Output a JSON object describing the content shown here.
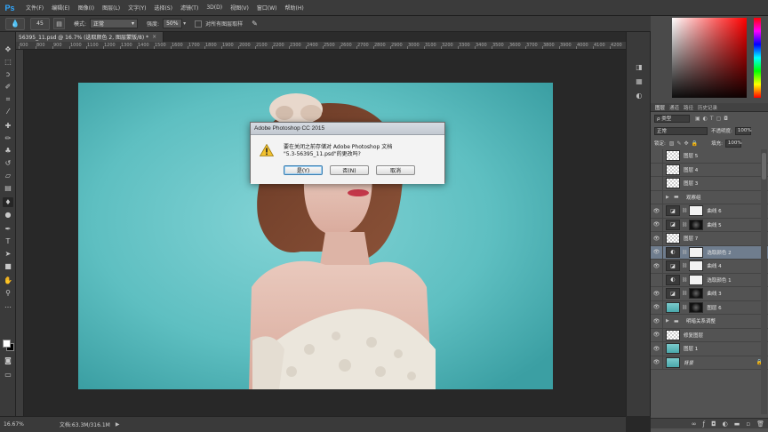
{
  "app": {
    "logo": "Ps"
  },
  "menu": [
    "文件(F)",
    "编辑(E)",
    "图像(I)",
    "图层(L)",
    "文字(Y)",
    "选择(S)",
    "滤镜(T)",
    "3D(D)",
    "视图(V)",
    "窗口(W)",
    "帮助(H)"
  ],
  "options": {
    "brush_size": "45",
    "mode_label": "模式:",
    "mode_value": "正常",
    "strength_label": "强度:",
    "strength_value": "50%",
    "sample_all_label": "对所有图层取样"
  },
  "document": {
    "tab_title": "56395_11.psd @ 16.7% (选取颜色 2, 图层蒙版/8) *",
    "ruler_ticks": [
      "600",
      "800",
      "900",
      "1000",
      "1100",
      "1200",
      "1300",
      "1400",
      "1500",
      "1600",
      "1700",
      "1800",
      "1900",
      "2000",
      "2100",
      "2200",
      "2300",
      "2400",
      "2500",
      "2600",
      "2700",
      "2800",
      "2900",
      "3000",
      "3100",
      "3200",
      "3300",
      "3400",
      "3500",
      "3600",
      "3700",
      "3800",
      "3900",
      "4000",
      "4100",
      "4200"
    ]
  },
  "status": {
    "zoom": "16.67%",
    "doc_info": "文档:63.3M/316.1M"
  },
  "dialog": {
    "title": "Adobe Photoshop CC 2015",
    "message_line1": "要在关闭之前存储对 Adobe Photoshop 文档",
    "message_line2": "\"5.3-56395_11.psd\"的更改吗?",
    "buttons": {
      "yes": "是(Y)",
      "no": "否(N)",
      "cancel": "取消"
    }
  },
  "layers_panel": {
    "tabs": [
      "图层",
      "通道",
      "路径",
      "历史记录"
    ],
    "filter_label": "ρ 类型",
    "blend_mode": "正常",
    "opacity_label": "不透明度:",
    "opacity_value": "100%",
    "lock_label": "锁定:",
    "fill_label": "填充:",
    "fill_value": "100%",
    "layers": [
      {
        "name": "图层 5",
        "visible": false,
        "kind": "pixel"
      },
      {
        "name": "图层 4",
        "visible": false,
        "kind": "pixel"
      },
      {
        "name": "图层 3",
        "visible": false,
        "kind": "pixel"
      },
      {
        "name": "观察组",
        "visible": false,
        "kind": "group"
      },
      {
        "name": "曲线 6",
        "visible": true,
        "kind": "curves",
        "mask": "light"
      },
      {
        "name": "曲线 5",
        "visible": true,
        "kind": "curves",
        "mask": "dark"
      },
      {
        "name": "图层 7",
        "visible": true,
        "kind": "pixel"
      },
      {
        "name": "选取颜色 2",
        "visible": true,
        "kind": "selective",
        "mask": "light",
        "selected": true
      },
      {
        "name": "曲线 4",
        "visible": true,
        "kind": "curves",
        "mask": "light"
      },
      {
        "name": "选取颜色 1",
        "visible": false,
        "kind": "selective",
        "mask": "light"
      },
      {
        "name": "曲线 3",
        "visible": true,
        "kind": "curves",
        "mask": "dark"
      },
      {
        "name": "图层 6",
        "visible": true,
        "kind": "photo",
        "mask": "dark"
      },
      {
        "name": "明暗关系调整",
        "visible": true,
        "kind": "group"
      },
      {
        "name": "修复图层",
        "visible": true,
        "kind": "pixel"
      },
      {
        "name": "图层 1",
        "visible": true,
        "kind": "photo"
      },
      {
        "name": "背景",
        "visible": true,
        "kind": "photo",
        "italic": true,
        "locked": true
      }
    ]
  },
  "colors": {
    "ps_blue": "#31a8ff",
    "backdrop_teal": "#5cbcbe",
    "selected_layer": "#6f7d8e"
  }
}
